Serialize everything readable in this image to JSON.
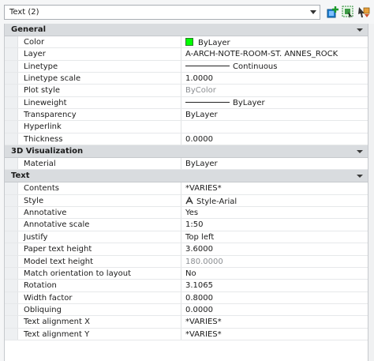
{
  "selector": {
    "value": "Text (2)"
  },
  "toolbar": {
    "quick_select_icon": "quick-select-icon",
    "select_objects_icon": "select-objects-icon",
    "pickadd_icon": "pickadd-toggle-icon"
  },
  "colors": {
    "bylayer_green": "#00ff00",
    "section_bg": "#d9dcdf"
  },
  "sections": {
    "general": {
      "title": "General",
      "rows": [
        {
          "label": "Color",
          "value": "ByLayer"
        },
        {
          "label": "Layer",
          "value": "A-ARCH-NOTE-ROOM-ST. ANNES_ROCK"
        },
        {
          "label": "Linetype",
          "value": "Continuous"
        },
        {
          "label": "Linetype scale",
          "value": "1.0000"
        },
        {
          "label": "Plot style",
          "value": "ByColor"
        },
        {
          "label": "Lineweight",
          "value": "ByLayer"
        },
        {
          "label": "Transparency",
          "value": "ByLayer"
        },
        {
          "label": "Hyperlink",
          "value": ""
        },
        {
          "label": "Thickness",
          "value": "0.0000"
        }
      ]
    },
    "viz": {
      "title": "3D Visualization",
      "rows": [
        {
          "label": "Material",
          "value": "ByLayer"
        }
      ]
    },
    "text": {
      "title": "Text",
      "rows": [
        {
          "label": "Contents",
          "value": "*VARIES*"
        },
        {
          "label": "Style",
          "value": "Style-Arial"
        },
        {
          "label": "Annotative",
          "value": "Yes"
        },
        {
          "label": "Annotative scale",
          "value": "1:50"
        },
        {
          "label": "Justify",
          "value": "Top left"
        },
        {
          "label": "Paper text height",
          "value": "3.6000"
        },
        {
          "label": "Model text height",
          "value": "180.0000"
        },
        {
          "label": "Match orientation to layout",
          "value": "No"
        },
        {
          "label": "Rotation",
          "value": "3.1065"
        },
        {
          "label": "Width factor",
          "value": "0.8000"
        },
        {
          "label": "Obliquing",
          "value": "0.0000"
        },
        {
          "label": "Text alignment X",
          "value": "*VARIES*"
        },
        {
          "label": "Text alignment Y",
          "value": "*VARIES*"
        }
      ]
    }
  }
}
